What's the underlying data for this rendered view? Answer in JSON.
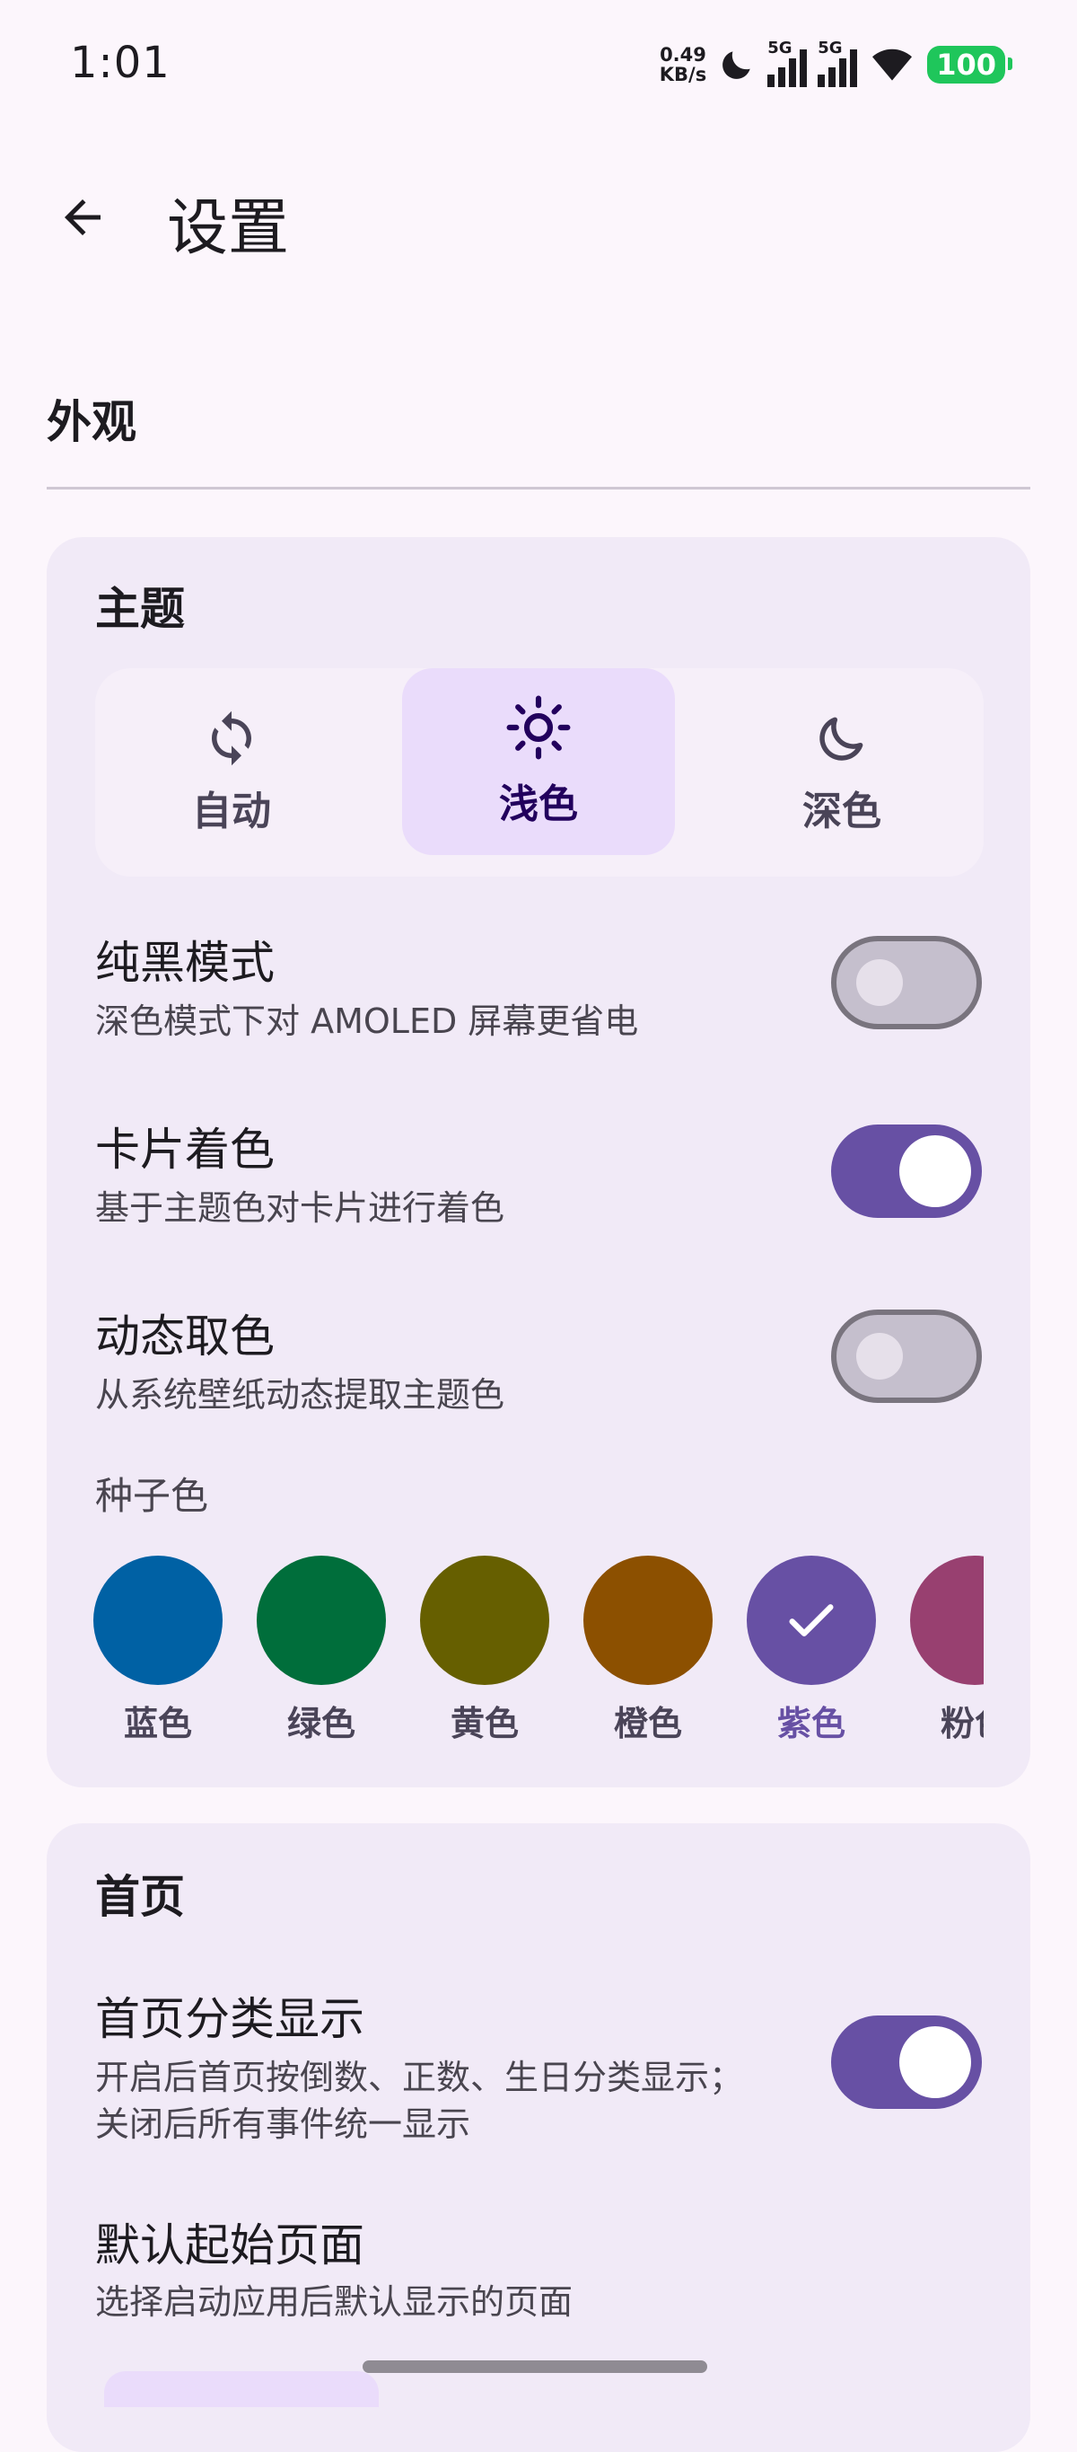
{
  "status_bar": {
    "time": "1:01",
    "net_speed_value": "0.49",
    "net_speed_unit": "KB/s",
    "signal1": "5G",
    "signal2": "5G",
    "battery": "100"
  },
  "app_bar": {
    "title": "设置"
  },
  "appearance": {
    "section_title": "外观",
    "theme": {
      "title": "主题",
      "options": [
        {
          "label": "自动",
          "icon": "sync-icon",
          "selected": false
        },
        {
          "label": "浅色",
          "icon": "sun-icon",
          "selected": true
        },
        {
          "label": "深色",
          "icon": "moon-icon",
          "selected": false
        }
      ]
    },
    "pure_black": {
      "title": "纯黑模式",
      "desc": "深色模式下对 AMOLED 屏幕更省电",
      "on": false
    },
    "card_tint": {
      "title": "卡片着色",
      "desc": "基于主题色对卡片进行着色",
      "on": true
    },
    "dynamic_color": {
      "title": "动态取色",
      "desc": "从系统壁纸动态提取主题色",
      "on": false
    },
    "seed": {
      "title": "种子色",
      "colors": [
        {
          "label": "蓝色",
          "color": "#0061a4"
        },
        {
          "label": "绿色",
          "color": "#006e3b"
        },
        {
          "label": "黄色",
          "color": "#665f00"
        },
        {
          "label": "橙色",
          "color": "#8c5000"
        },
        {
          "label": "紫色",
          "color": "#6750a4",
          "selected": true
        },
        {
          "label": "粉色",
          "color": "#984070"
        }
      ]
    }
  },
  "home": {
    "title": "首页",
    "category_display": {
      "title": "首页分类显示",
      "desc_line1": "开启后首页按倒数、正数、生日分类显示；",
      "desc_line2": "关闭后所有事件统一显示",
      "on": true
    },
    "default_page": {
      "title": "默认起始页面",
      "desc": "选择启动应用后默认显示的页面"
    }
  }
}
